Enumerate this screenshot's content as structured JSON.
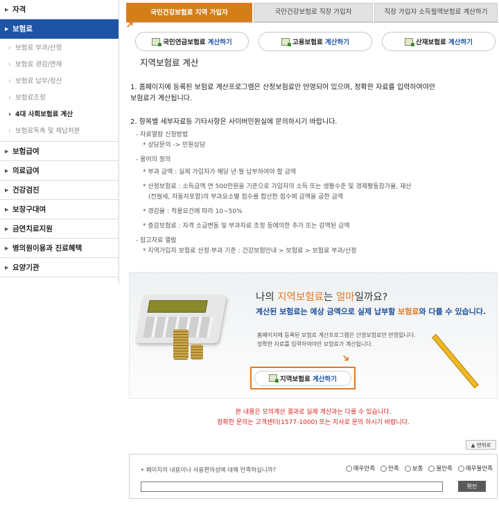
{
  "sidebar": {
    "items": [
      {
        "label": "자격"
      },
      {
        "label": "보험료"
      },
      {
        "label": "보험료 부과/산정"
      },
      {
        "label": "보험료 경감/면제"
      },
      {
        "label": "보험료 납부/정산"
      },
      {
        "label": "보험료조정"
      },
      {
        "label": "4대 사회보험료 계산"
      },
      {
        "label": "보험료독촉 및 체납처분"
      },
      {
        "label": "보험급여"
      },
      {
        "label": "의료급여"
      },
      {
        "label": "건강검진"
      },
      {
        "label": "보장구대여"
      },
      {
        "label": "금연치료지원"
      },
      {
        "label": "병의원이용과 진료혜택"
      },
      {
        "label": "요양기관"
      }
    ]
  },
  "tabs": [
    {
      "label": "국민건강보험료 지역 가입자"
    },
    {
      "label": "국민건강보험료 직장 가입자"
    },
    {
      "label": "직장 가입자 소득월액보험료 계산하기"
    }
  ],
  "calc_buttons": [
    {
      "name": "국민연금보험료",
      "action": "계산하기"
    },
    {
      "name": "고용보험료",
      "action": "계산하기"
    },
    {
      "name": "산재보험료",
      "action": "계산하기"
    }
  ],
  "content": {
    "title": "지역보험료 계산",
    "p1_line1": "1. 홈페이지에 등록된 보험료 계산프로그램은 산정보험료만 반영되어 있으며, 정확한 자료를 입력하여야만",
    "p1_line2": "보험료가 계산됩니다.",
    "p2": "2. 항목별 세부자료등 기타사항은 사이버민원실에 문의하시기 바랍니다.",
    "g1_title": "- 자료열람 신청방법",
    "g1_item": "* 상담문의 -> 민원상담",
    "g2_title": "- 용어의 정의",
    "g2_item1": "* 부과 금액 : 실제 가입자가 해당 년·월 납부하여야 할 금액",
    "g2_item2a": "* 산정보험료 : 소득금액 연 500만원을 기준으로 가입자의 소득 또는 생활수준 및 경제활동참가율, 재산",
    "g2_item2b": "(전월세, 자동차포함)의 부과요소별 점수를 합산한 점수에 금액을 곱한 금액",
    "g2_item3": "* 경감율 : 적용요건에 따라 10~50%",
    "g2_item4": "* 증감보험료 : 자격 소급변동 및 부과자료 조정 등에의한 추가 또는 감액된 금액",
    "g3_title": "- 참고자료 열람",
    "g3_item": "* 지역가입자 보험료 산정·부과 기준 : 건강보험안내 > 보험료 > 보험료 부과/산정"
  },
  "banner": {
    "title_pre": "나의 ",
    "title_hl1": "지역보험료",
    "title_mid": "는 ",
    "title_hl2": "얼마",
    "title_post": "일까요?",
    "sub_pre": "계산된 보험료는 예상 금액으로 실제 납부할 ",
    "sub_hl": "보험료",
    "sub_post": "와 다를 수 있습니다.",
    "small1": "홈페이지에 등록된 보험료 계산프로그램은 산정보험료만 반영됩니다.",
    "small2": "정확한 자료를 입력하여야만 보험료가 계산됩니다.",
    "btn_name": "지역보험료",
    "btn_action": "계산하기"
  },
  "notice": {
    "line1": "본 내용은 모의계산 결과로 실제 계산과는 다를 수 있습니다.",
    "line2": "정확한 문의는 고객센터(1577-1000) 또는 지사로 문의 하시기 바랍니다."
  },
  "top_button": "맨위로",
  "survey": {
    "question": "페이지의 내용이나 사용편의성에 대해 만족하십니까?",
    "options": [
      "매우만족",
      "만족",
      "보통",
      "불만족",
      "매우불만족"
    ],
    "confirm": "확인"
  },
  "colors": {
    "accent": "#e27924",
    "nav_active": "#1f53a5",
    "notice": "#d8201c"
  }
}
